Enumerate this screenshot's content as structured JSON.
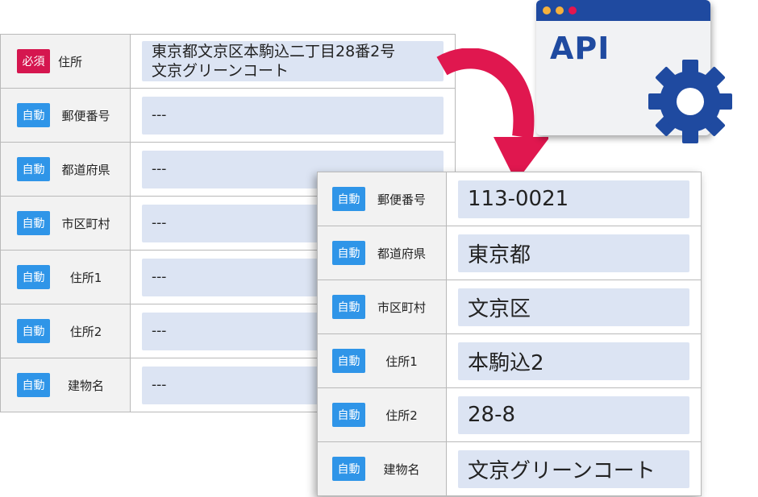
{
  "back_form": {
    "rows": [
      {
        "badge": "必須",
        "type": "req",
        "label": "住所",
        "value": "東京都文京区本駒込二丁目28番2号",
        "value2": "文京グリーンコート"
      },
      {
        "badge": "自動",
        "type": "auto",
        "label": "郵便番号",
        "value": "---"
      },
      {
        "badge": "自動",
        "type": "auto",
        "label": "都道府県",
        "value": "---"
      },
      {
        "badge": "自動",
        "type": "auto",
        "label": "市区町村",
        "value": "---"
      },
      {
        "badge": "自動",
        "type": "auto",
        "label": "住所1",
        "value": "---"
      },
      {
        "badge": "自動",
        "type": "auto",
        "label": "住所2",
        "value": "---"
      },
      {
        "badge": "自動",
        "type": "auto",
        "label": "建物名",
        "value": "---"
      }
    ]
  },
  "front_form": {
    "rows": [
      {
        "badge": "自動",
        "label": "郵便番号",
        "value": "113-0021"
      },
      {
        "badge": "自動",
        "label": "都道府県",
        "value": "東京都"
      },
      {
        "badge": "自動",
        "label": "市区町村",
        "value": "文京区"
      },
      {
        "badge": "自動",
        "label": "住所1",
        "value": "本駒込2"
      },
      {
        "badge": "自動",
        "label": "住所2",
        "value": "28-8"
      },
      {
        "badge": "自動",
        "label": "建物名",
        "value": "文京グリーンコート"
      }
    ]
  },
  "api_window": {
    "label": "API",
    "icon": "gear-icon",
    "dots": [
      "#f5b13d",
      "#f5b13d",
      "#e3164f"
    ]
  },
  "colors": {
    "required": "#d5164f",
    "auto": "#2f95e8",
    "value_bg": "#dce4f3",
    "api_blue": "#1f4aa0",
    "arrow": "#e0174f"
  }
}
